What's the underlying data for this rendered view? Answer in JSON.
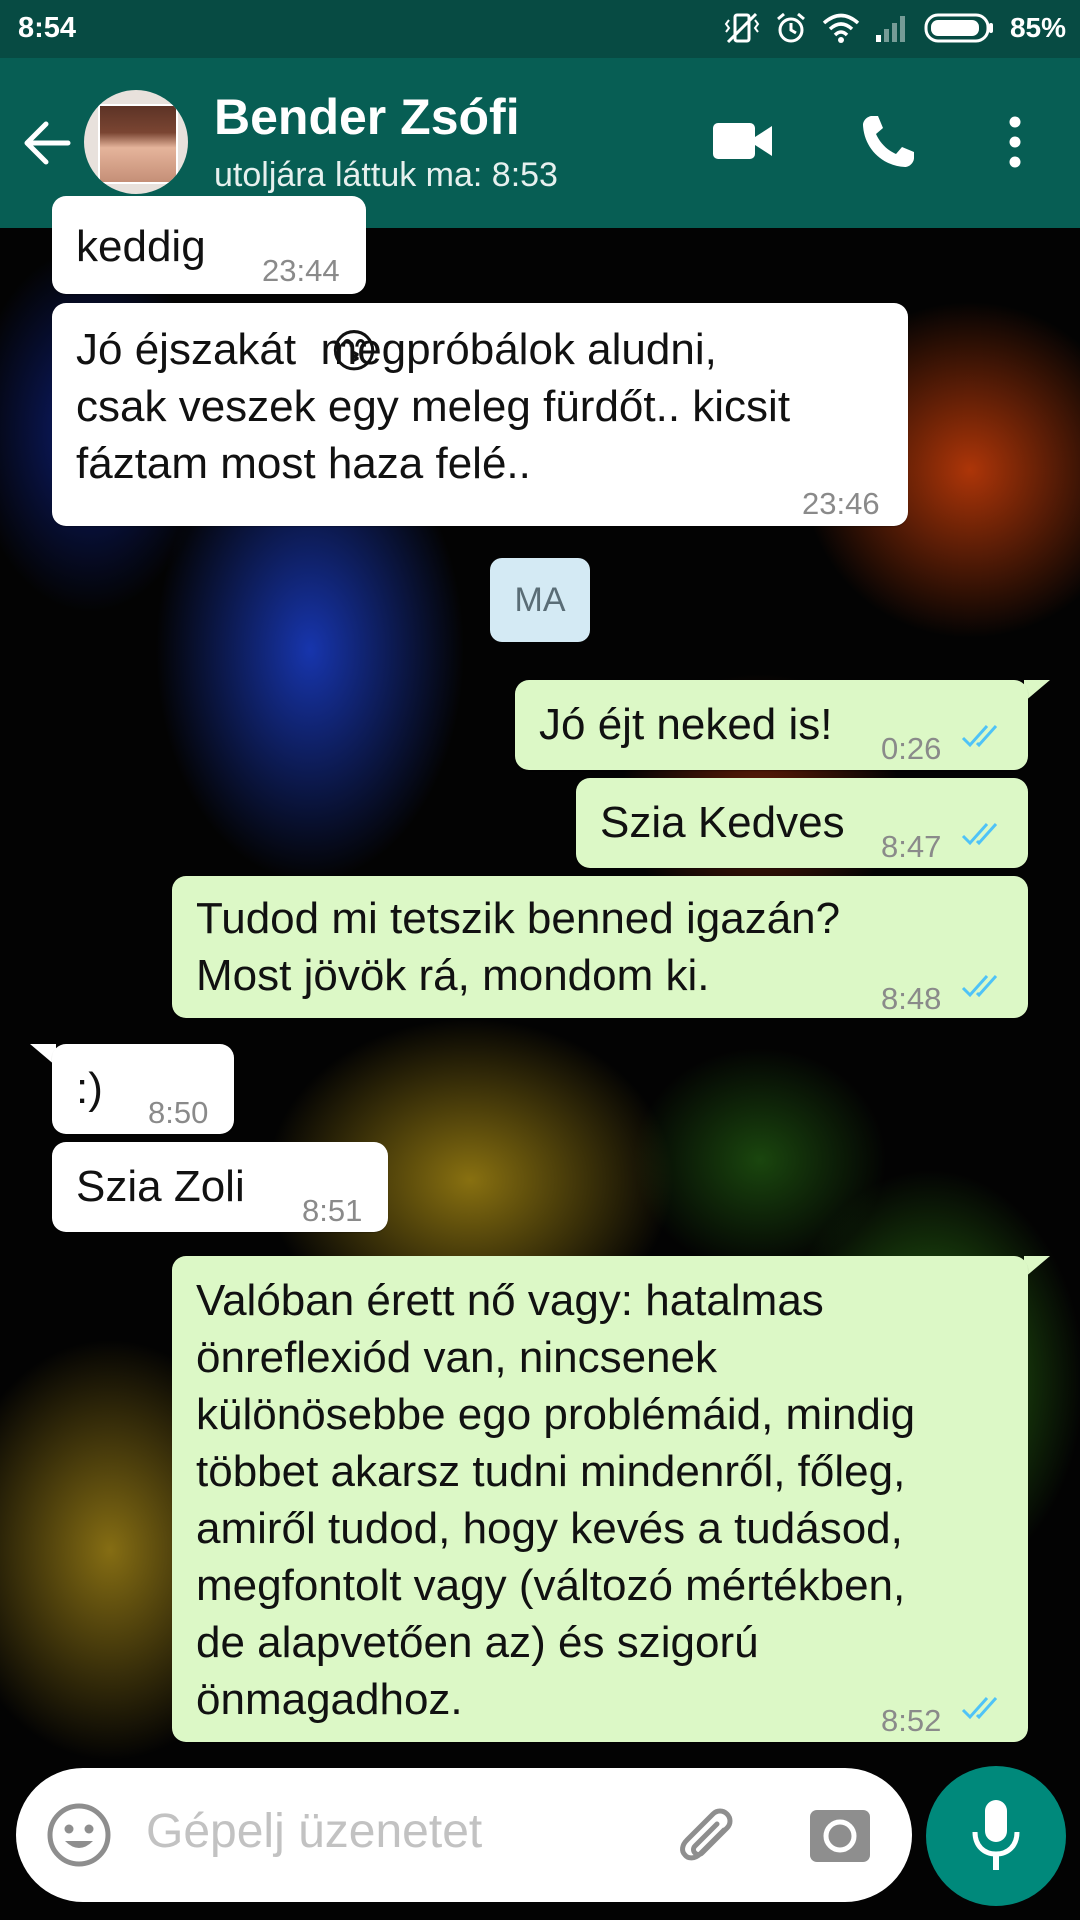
{
  "status_bar": {
    "time": "8:54",
    "battery": "85%"
  },
  "header": {
    "contact_name": "Bender Zsófi",
    "last_seen": "utoljára láttuk ma: 8:53",
    "icons": [
      "back-arrow-icon",
      "video-call-icon",
      "phone-icon",
      "more-options-icon"
    ]
  },
  "messages": [
    {
      "direction": "incoming",
      "text": "keddig",
      "time": "23:44"
    },
    {
      "direction": "incoming",
      "text": "Jó éjszakát 😙 megpróbálok aludni, csak veszek egy meleg fürdőt.. kicsit fáztam most haza felé..",
      "lines": [
        "Jó éjszakát  megpróbálok aludni,",
        "csak veszek egy meleg fürdőt.. kicsit",
        "fáztam most haza felé.."
      ],
      "emoji": "😙",
      "time": "23:46"
    },
    {
      "direction": "date",
      "text": "MA"
    },
    {
      "direction": "outgoing",
      "text": "Jó éjt neked is!",
      "time": "0:26",
      "status": "read"
    },
    {
      "direction": "outgoing",
      "text": "Szia Kedves",
      "time": "8:47",
      "status": "read"
    },
    {
      "direction": "outgoing",
      "text": "Tudod mi tetszik benned igazán? Most jövök rá, mondom ki.",
      "lines": [
        "Tudod mi tetszik benned igazán?",
        "Most jövök rá, mondom ki."
      ],
      "time": "8:48",
      "status": "read"
    },
    {
      "direction": "incoming",
      "text": ":)",
      "time": "8:50"
    },
    {
      "direction": "incoming",
      "text": "Szia Zoli",
      "time": "8:51"
    },
    {
      "direction": "outgoing",
      "text": "Valóban érett nő vagy: hatalmas önreflexiód van, nincsenek különösebbe ego problémáid, mindig többet akarsz tudni mindenről, főleg, amiről tudod, hogy kevés a tudásod, megfontolt vagy (változó mértékben, de alapvetően az) és szigorú önmagadhoz.",
      "lines": [
        "Valóban érett nő vagy: hatalmas",
        "önreflexiód van, nincsenek",
        "különösebbe ego problémáid, mindig",
        "többet akarsz tudni mindenről, főleg,",
        "amiről tudod, hogy kevés a tudásod,",
        "megfontolt vagy (változó mértékben,",
        "de alapvetően az) és szigorú",
        "önmagadhoz."
      ],
      "time": "8:52",
      "status": "read"
    }
  ],
  "composer": {
    "placeholder": "Gépelj üzenetet",
    "icons": [
      "emoji-icon",
      "attachment-icon",
      "camera-icon",
      "microphone-icon"
    ]
  },
  "colors": {
    "header": "#075e54",
    "status_bar": "#074b43",
    "outgoing_bubble": "#dcf8c6",
    "incoming_bubble": "#ffffff",
    "read_ticks": "#4fc3f7",
    "mic_button": "#00897b"
  }
}
